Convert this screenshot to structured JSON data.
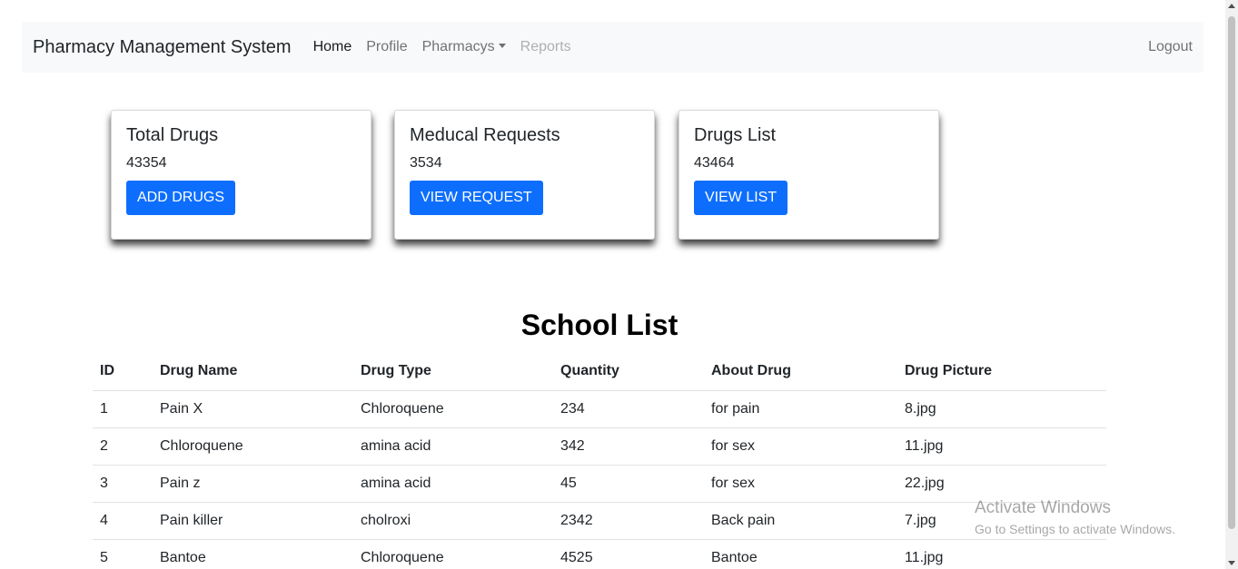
{
  "navbar": {
    "brand": "Pharmacy Management System",
    "links": [
      {
        "label": "Home"
      },
      {
        "label": "Profile"
      },
      {
        "label": "Pharmacys"
      },
      {
        "label": "Reports"
      }
    ],
    "logout": "Logout"
  },
  "cards": [
    {
      "title": "Total Drugs",
      "value": "43354",
      "button": "ADD DRUGS"
    },
    {
      "title": "Meducal Requests",
      "value": "3534",
      "button": "VIEW REQUEST"
    },
    {
      "title": "Drugs List",
      "value": "43464",
      "button": "VIEW LIST"
    }
  ],
  "list": {
    "title": "School List",
    "headers": [
      "ID",
      "Drug Name",
      "Drug Type",
      "Quantity",
      "About Drug",
      "Drug Picture"
    ],
    "rows": [
      [
        "1",
        "Pain X",
        "Chloroquene",
        "234",
        "for pain",
        "8.jpg"
      ],
      [
        "2",
        "Chloroquene",
        "amina acid",
        "342",
        "for sex",
        "11.jpg"
      ],
      [
        "3",
        "Pain z",
        "amina acid",
        "45",
        "for sex",
        "22.jpg"
      ],
      [
        "4",
        "Pain killer",
        "cholroxi",
        "2342",
        "Back pain",
        "7.jpg"
      ],
      [
        "5",
        "Bantoe",
        "Chloroquene",
        "4525",
        "Bantoe",
        "11.jpg"
      ]
    ]
  },
  "watermark": {
    "line1": "Activate Windows",
    "line2": "Go to Settings to activate Windows."
  },
  "colors": {
    "primary": "#0d6efd",
    "navbar_bg": "#f8f9fa"
  }
}
